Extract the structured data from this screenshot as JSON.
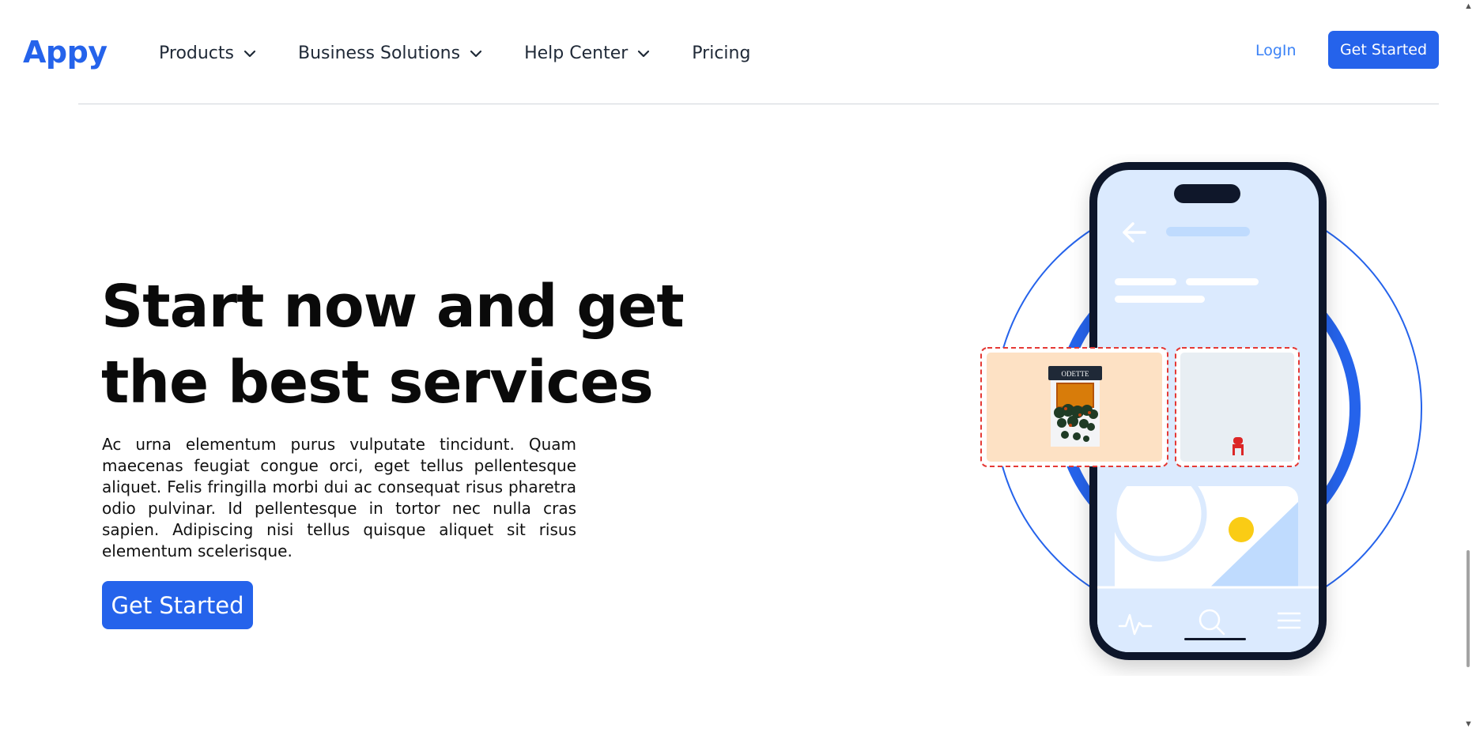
{
  "brand": {
    "name": "Appy",
    "color": "#2563eb"
  },
  "nav": {
    "items": [
      {
        "label": "Products",
        "has_dropdown": true
      },
      {
        "label": "Business Solutions",
        "has_dropdown": true
      },
      {
        "label": "Help Center",
        "has_dropdown": true
      },
      {
        "label": "Pricing",
        "has_dropdown": false
      }
    ],
    "login_label": "LogIn",
    "cta_label": "Get Started"
  },
  "hero": {
    "title": "Start now and get the best services",
    "paragraph": "Ac urna elementum purus vulputate tincidunt. Quam maecenas feugiat congue orci, eget tellus pellentesque aliquet. Felis fringilla morbi dui ac consequat risus pharetra odio pulvinar. Id pellentesque in tortor nec nulla cras sapien. Adipiscing nisi tellus quisque aliquet sit risus elementum scelerisque.",
    "cta_label": "Get Started"
  },
  "illustration": {
    "storefront_sign": "ODETTE",
    "icons": [
      "back-arrow-icon",
      "heartbeat-icon",
      "search-icon",
      "menu-icon"
    ],
    "colors": {
      "accent": "#2563eb",
      "phone_frame": "#0f172a",
      "phone_screen": "#dbeafe",
      "sun": "#facc15",
      "card_border": "#e53935"
    }
  }
}
